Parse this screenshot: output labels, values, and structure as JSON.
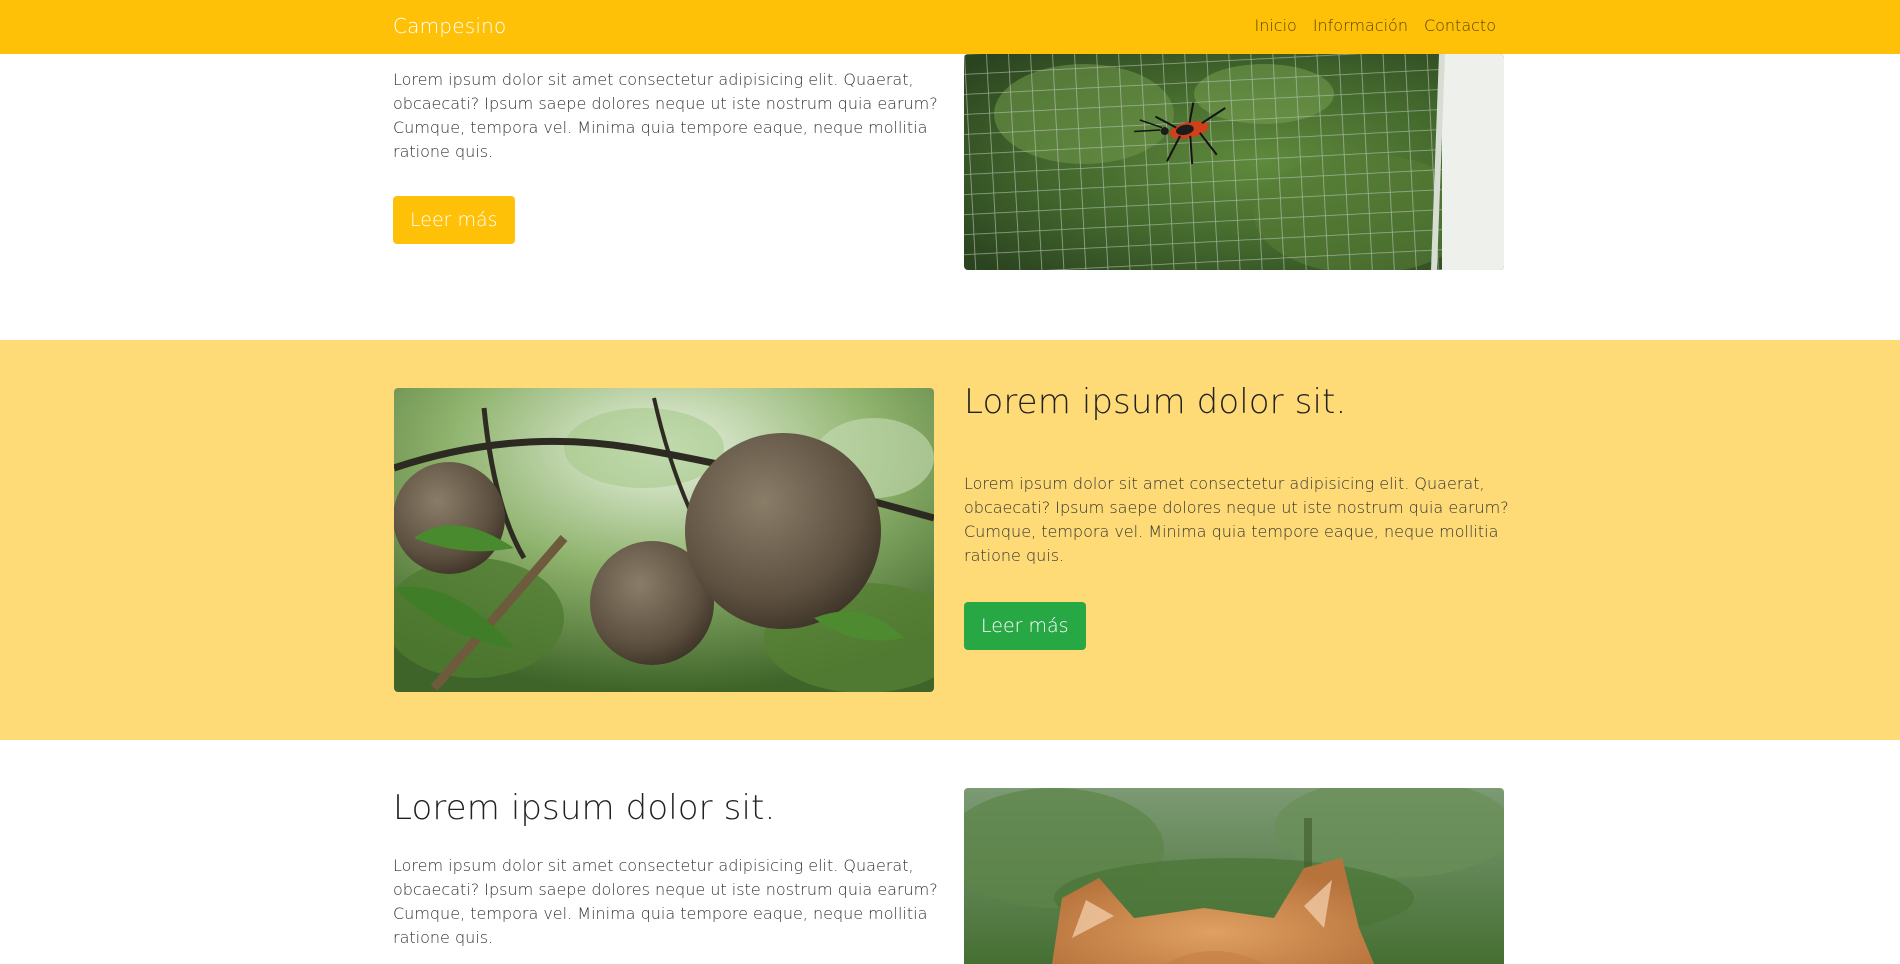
{
  "nav": {
    "brand": "Campesino",
    "links": [
      "Inicio",
      "Información",
      "Contacto"
    ]
  },
  "sections": [
    {
      "paragraph": "Lorem ipsum dolor sit amet consectetur adipisicing elit. Quaerat, obcaecati? Ipsum saepe dolores neque ut iste nostrum quia earum? Cumque, tempora vel. Minima quia tempore eaque, neque mollitia ratione quis.",
      "button": "Leer más",
      "image_alt": "Red and black insect on a wire mesh screen"
    },
    {
      "heading": "Lorem ipsum dolor sit.",
      "paragraph": "Lorem ipsum dolor sit amet consectetur adipisicing elit. Quaerat, obcaecati? Ipsum saepe dolores neque ut iste nostrum quia earum? Cumque, tempora vel. Minima quia tempore eaque, neque mollitia ratione quis.",
      "button": "Leer más",
      "image_alt": "Round fruits hanging from a tree branch"
    },
    {
      "heading": "Lorem ipsum dolor sit.",
      "paragraph": "Lorem ipsum dolor sit amet consectetur adipisicing elit. Quaerat, obcaecati? Ipsum saepe dolores neque ut iste nostrum quia earum? Cumque, tempora vel. Minima quia tempore eaque, neque mollitia ratione quis.",
      "image_alt": "Orange cat ears in front of green foliage"
    }
  ],
  "colors": {
    "navbar": "#ffc107",
    "highlight_section": "#ffdb77",
    "button_yellow": "#ffc107",
    "button_green": "#28a745"
  }
}
